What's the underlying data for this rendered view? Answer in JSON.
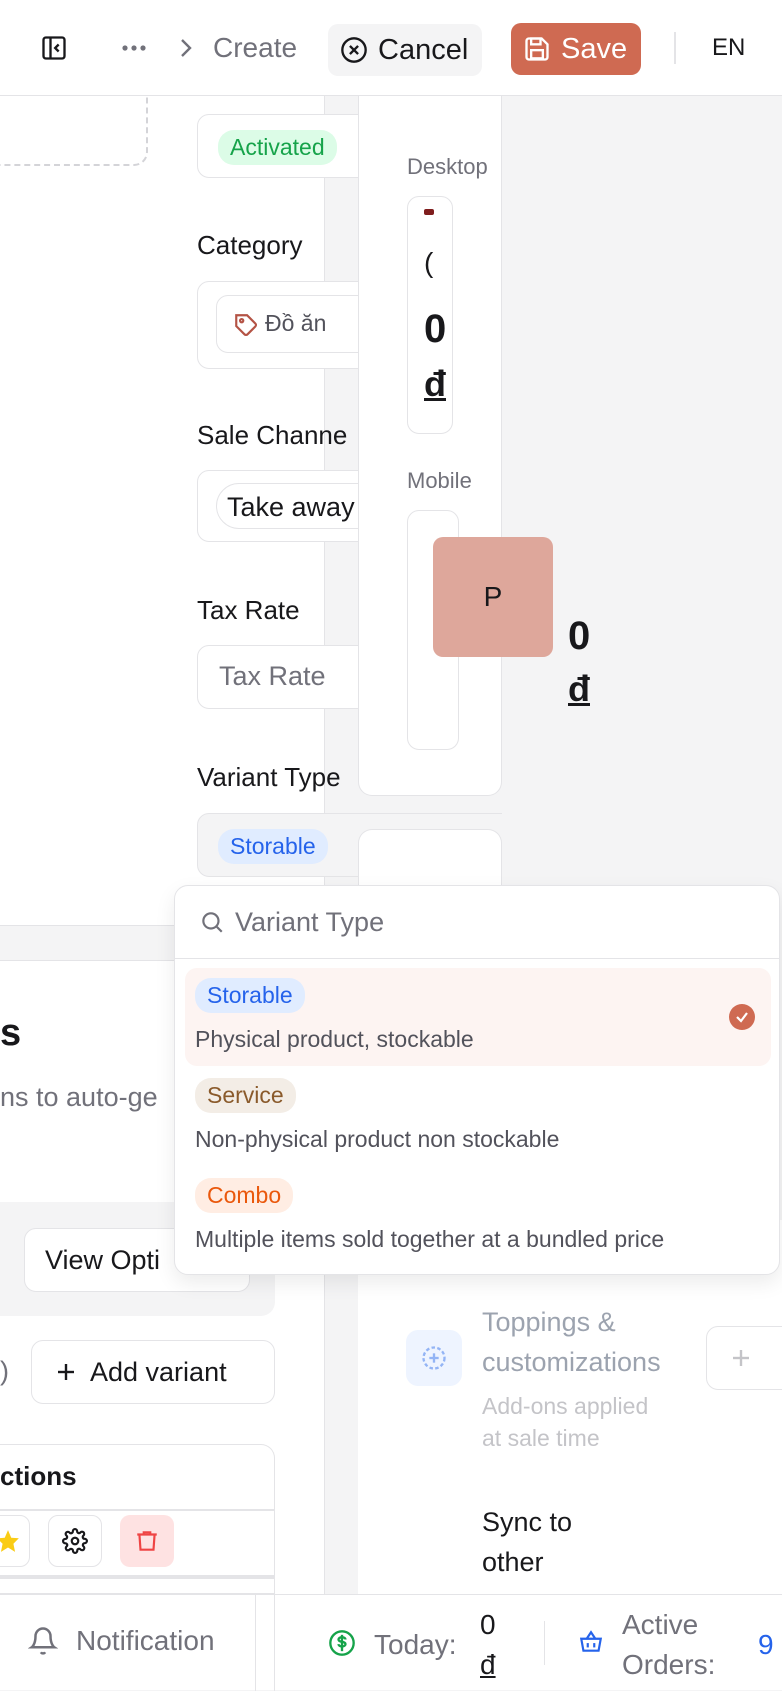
{
  "topbar": {
    "breadcrumb_current": "Create",
    "cancel_label": "Cancel",
    "save_label": "Save",
    "language": "EN"
  },
  "form": {
    "status_value": "Activated",
    "category_label": "Category",
    "category_value": "Đồ ăn",
    "sale_channel_label": "Sale Channe",
    "sale_channel_value": "Take away",
    "tax_rate_label": "Tax Rate",
    "tax_rate_placeholder": "Tax Rate",
    "variant_type_label": "Variant Type",
    "variant_type_value": "Storable"
  },
  "preview": {
    "desktop_label": "Desktop",
    "desktop_price": "0",
    "desktop_currency": "đ",
    "mobile_label": "Mobile",
    "mobile_thumb": "P",
    "mobile_price": "0",
    "mobile_currency": "đ"
  },
  "variants_section": {
    "title_fragment": "s",
    "subtitle_fragment": "ns to auto-ge",
    "view_options_label": "View Opti",
    "paren_fragment": ")",
    "add_variant_label": "Add variant",
    "table_header_fragment": "ctions"
  },
  "right_panel": {
    "toppings_title_1": "Toppings &",
    "toppings_title_2": "customizations",
    "toppings_desc_1": "Add-ons applied",
    "toppings_desc_2": "at sale time",
    "sync_title_1": "Sync to",
    "sync_title_2": "other"
  },
  "dropdown": {
    "search_placeholder": "Variant Type",
    "options": [
      {
        "badge": "Storable",
        "description": "Physical product, stockable",
        "selected": true
      },
      {
        "badge": "Service",
        "description": "Non-physical product non stockable",
        "selected": false
      },
      {
        "badge": "Combo",
        "description": "Multiple items sold together at a bundled price",
        "selected": false
      }
    ]
  },
  "bottombar": {
    "notification_label": "Notification",
    "today_label": "Today:",
    "today_value": "0",
    "today_currency": "đ",
    "active_orders_label_1": "Active",
    "active_orders_label_2": "Orders:",
    "active_orders_value": "9"
  },
  "colors": {
    "accent": "#cf6a52",
    "green": "#16a34a",
    "blue": "#2563eb"
  }
}
